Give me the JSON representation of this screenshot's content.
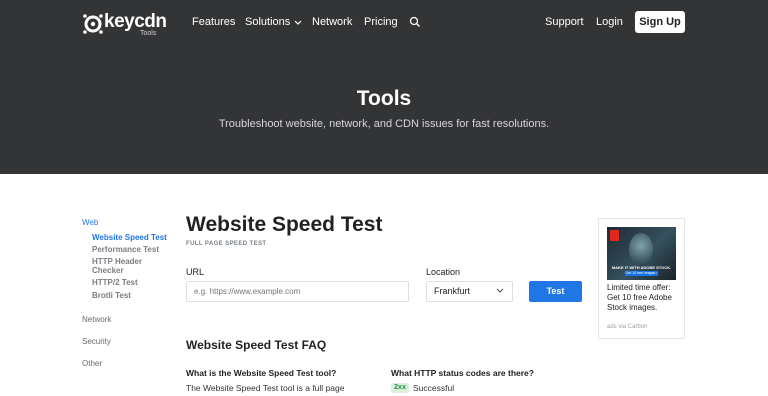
{
  "brand": {
    "name": "keycdn",
    "sub": "Tools"
  },
  "nav": {
    "features": "Features",
    "solutions": "Solutions",
    "network": "Network",
    "pricing": "Pricing",
    "support": "Support",
    "login": "Login",
    "signup": "Sign Up"
  },
  "hero": {
    "title": "Tools",
    "subtitle": "Troubleshoot website, network, and CDN issues for fast resolutions."
  },
  "sidebar": {
    "web": "Web",
    "items": [
      "Website Speed Test",
      "Performance Test",
      "HTTP Header Checker",
      "HTTP/2 Test",
      "Brotli Test"
    ],
    "network": "Network",
    "security": "Security",
    "other": "Other"
  },
  "main": {
    "title": "Website Speed Test",
    "subtitle": "FULL PAGE SPEED TEST",
    "url_label": "URL",
    "url_placeholder": "e.g. https://www.example.com",
    "location_label": "Location",
    "location_value": "Frankfurt",
    "test_button": "Test"
  },
  "faq": {
    "title": "Website Speed Test FAQ",
    "q1": "What is the Website Speed Test tool?",
    "a1": "The Website Speed Test tool is a full page",
    "q2": "What HTTP status codes are there?",
    "badge": "2xx",
    "a2": "Successful"
  },
  "ad": {
    "image_caption": "MAKE IT WITH ADOBE STOCK.",
    "image_cta": "Get 10 free images ›",
    "text": "Limited time offer: Get 10 free Adobe Stock images.",
    "via": "ads via Carbon"
  },
  "colors": {
    "header_bg": "#333436",
    "accent": "#2176e6",
    "badge_bg": "#d9f0dd",
    "badge_fg": "#2e8b43"
  }
}
